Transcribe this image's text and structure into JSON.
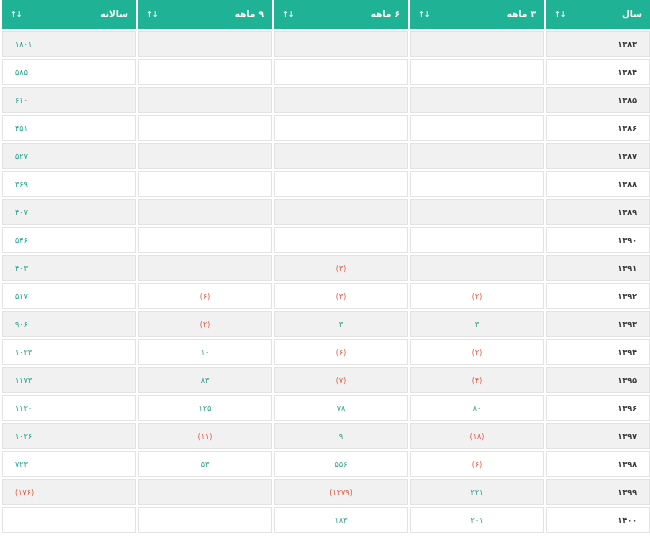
{
  "table": {
    "headers": [
      {
        "label": "سال",
        "sort_icon": "↓↑"
      },
      {
        "label": "۳ ماهه",
        "sort_icon": "↓↑"
      },
      {
        "label": "۶ ماهه",
        "sort_icon": "↓↑"
      },
      {
        "label": "۹ ماهه",
        "sort_icon": "↓↑"
      },
      {
        "label": "سالانه",
        "sort_icon": "↓↑"
      }
    ],
    "rows": [
      {
        "year": "۱۳۸۳",
        "q3": "",
        "q6": "",
        "q9": "",
        "annual": "۱۸۰۱"
      },
      {
        "year": "۱۳۸۴",
        "q3": "",
        "q6": "",
        "q9": "",
        "annual": "۵۸۵"
      },
      {
        "year": "۱۳۸۵",
        "q3": "",
        "q6": "",
        "q9": "",
        "annual": "۶۱۰"
      },
      {
        "year": "۱۳۸۶",
        "q3": "",
        "q6": "",
        "q9": "",
        "annual": "۴۵۱"
      },
      {
        "year": "۱۳۸۷",
        "q3": "",
        "q6": "",
        "q9": "",
        "annual": "۵۲۷"
      },
      {
        "year": "۱۳۸۸",
        "q3": "",
        "q6": "",
        "q9": "",
        "annual": "۳۶۹"
      },
      {
        "year": "۱۳۸۹",
        "q3": "",
        "q6": "",
        "q9": "",
        "annual": "۴۰۷"
      },
      {
        "year": "۱۳۹۰",
        "q3": "",
        "q6": "",
        "q9": "",
        "annual": "۵۴۶"
      },
      {
        "year": "۱۳۹۱",
        "q3": "",
        "q6": "(۳)",
        "q9": "",
        "annual": "۴۰۳"
      },
      {
        "year": "۱۳۹۲",
        "q3": "(۲)",
        "q6": "(۳)",
        "q9": "(۶)",
        "annual": "۵۱۷"
      },
      {
        "year": "۱۳۹۳",
        "q3": "۳",
        "q6": "۳",
        "q9": "(۲)",
        "annual": "۹۰۶"
      },
      {
        "year": "۱۳۹۴",
        "q3": "(۲)",
        "q6": "(۶)",
        "q9": "۱۰",
        "annual": "۱۰۲۳"
      },
      {
        "year": "۱۳۹۵",
        "q3": "(۴)",
        "q6": "(۷)",
        "q9": "۸۳",
        "annual": "۱۱۷۳"
      },
      {
        "year": "۱۳۹۶",
        "q3": "۸۰",
        "q6": "۷۸",
        "q9": "۱۲۵",
        "annual": "۱۱۲۰"
      },
      {
        "year": "۱۳۹۷",
        "q3": "(۱۸)",
        "q6": "۹",
        "q9": "(۱۱)",
        "annual": "۱۰۲۶"
      },
      {
        "year": "۱۳۹۸",
        "q3": "(۶)",
        "q6": "۵۵۶",
        "q9": "۵۳",
        "annual": "۷۲۳"
      },
      {
        "year": "۱۳۹۹",
        "q3": "۲۲۱",
        "q6": "(۱۲۷۹)",
        "q9": "",
        "annual": "(۱۷۶)"
      },
      {
        "year": "۱۴۰۰",
        "q3": "۲۰۱",
        "q6": "۱۸۳",
        "q9": "",
        "annual": ""
      }
    ]
  },
  "colors": {
    "header_bg": "#1fb295",
    "positive": "#2a9a7e",
    "negative": "#e0513a",
    "row_alt": "#f1f1f1"
  }
}
